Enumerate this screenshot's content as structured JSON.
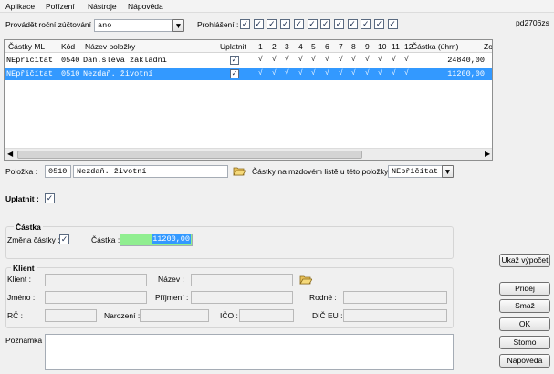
{
  "menu": [
    "Aplikace",
    "Pořízení",
    "Nástroje",
    "Nápověda"
  ],
  "form_id": "pd2706zs",
  "top": {
    "rocni_label": "Provádět roční zúčtování :",
    "rocni_value": "ano",
    "prohlaseni_label": "Prohlášení :",
    "prohlaseni_checked": [
      true,
      true,
      true,
      true,
      true,
      true,
      true,
      true,
      true,
      true,
      true,
      true
    ]
  },
  "grid": {
    "headers": {
      "castky_ml": "Částky ML",
      "kod": "Kód",
      "nazev": "Název položky",
      "uplatnit": "Uplatnit",
      "months": [
        "1",
        "2",
        "3",
        "4",
        "5",
        "6",
        "7",
        "8",
        "9",
        "10",
        "11",
        "12"
      ],
      "castka": "Částka (úhrn)",
      "zo": "Zo"
    },
    "rows": [
      {
        "castky_ml": "NEpřičítat",
        "kod": "0540",
        "nazev": "Daň.sleva základní",
        "uplatnit": true,
        "months": [
          "√",
          "√",
          "√",
          "√",
          "√",
          "√",
          "√",
          "√",
          "√",
          "√",
          "√",
          "√"
        ],
        "castka": "24840,00",
        "selected": false
      },
      {
        "castky_ml": "NEpřičítat",
        "kod": "0510",
        "nazev": "Nezdaň. životní",
        "uplatnit": true,
        "months": [
          "√",
          "√",
          "√",
          "√",
          "√",
          "√",
          "√",
          "√",
          "√",
          "√",
          "√",
          "√"
        ],
        "castka": "11200,00",
        "selected": true
      }
    ]
  },
  "polozka": {
    "label": "Položka :",
    "kod": "0510",
    "nazev": "Nezdaň. životní",
    "castky_label": "Částky na mzdovém listě u této položky :",
    "castky_value": "NEpřičítat"
  },
  "uplatnit": {
    "label": "Uplatnit :",
    "checked": true
  },
  "castka_group": {
    "title": "Částka",
    "zmena_label": "Změna částky :",
    "zmena_checked": true,
    "castka_label": "Částka :",
    "castka_value": "11200,00"
  },
  "klient": {
    "title": "Klient",
    "klient_label": "Klient :",
    "nazev_label": "Název :",
    "jmeno_label": "Jméno :",
    "prijmeni_label": "Příjmení :",
    "rodne_label": "Rodné :",
    "rc_label": "RČ :",
    "narozeni_label": "Narození :",
    "ico_label": "IČO :",
    "dic_label": "DIČ EU :"
  },
  "poznamka_label": "Poznámka :",
  "buttons": {
    "ukaz": "Ukaž výpočet",
    "pridej": "Přidej",
    "smaz": "Smaž",
    "ok": "OK",
    "storno": "Storno",
    "napoveda": "Nápověda"
  },
  "colors": {
    "selection": "#3399ff",
    "castka_bg": "#90ee90"
  }
}
